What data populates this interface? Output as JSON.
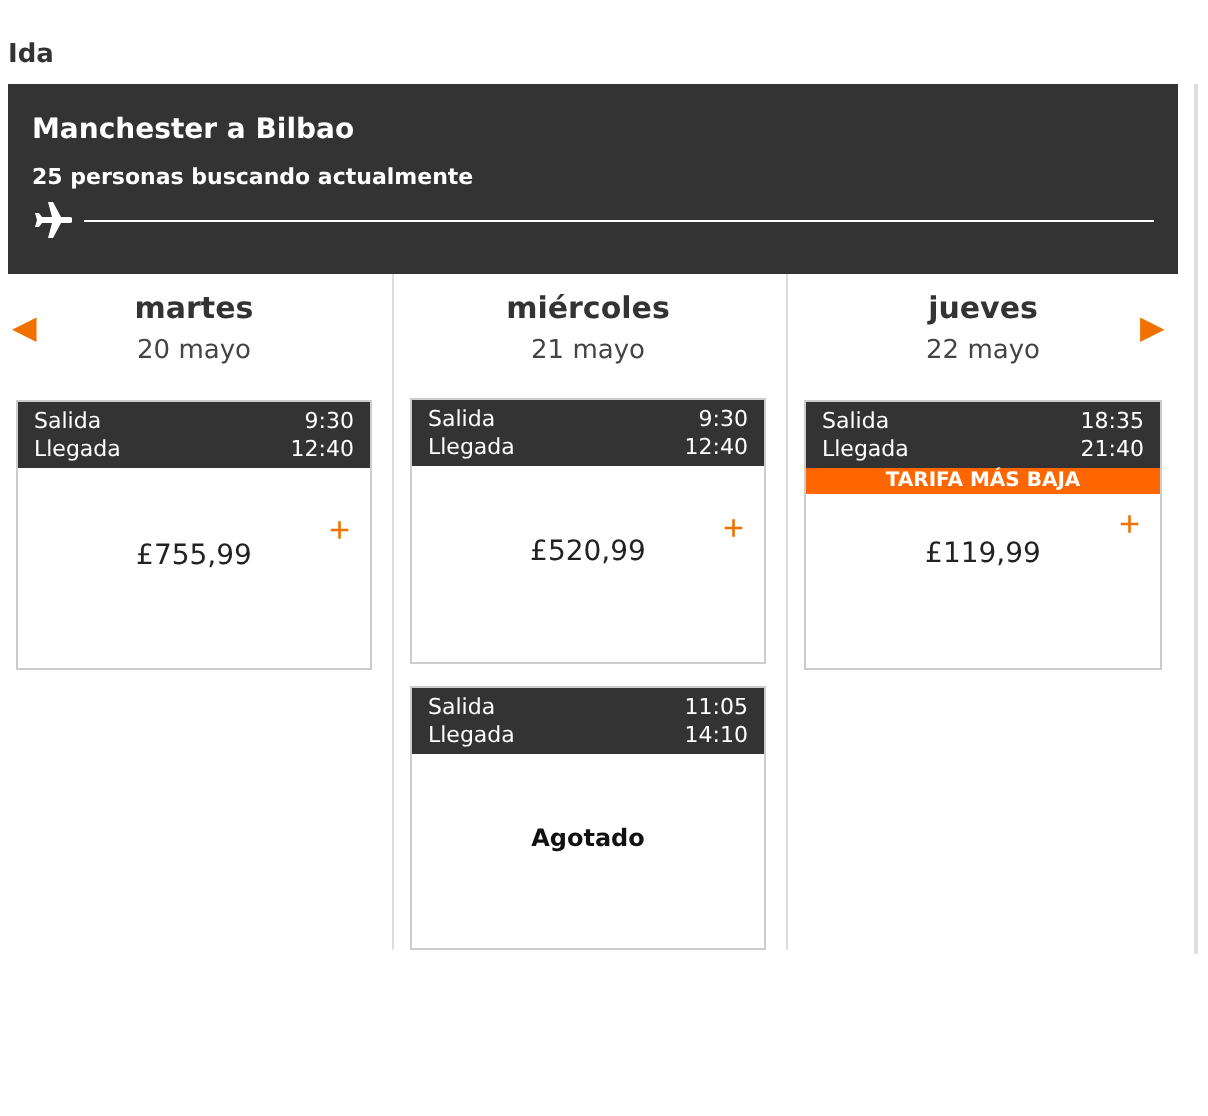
{
  "section_title": "Ida",
  "route": {
    "title": "Manchester a Bilbao",
    "subtitle": "25 personas buscando actualmente"
  },
  "nav": {
    "prev": "◀",
    "next": "▶"
  },
  "days": [
    {
      "weekday": "martes",
      "date": "20 mayo",
      "flights": [
        {
          "kind": "price",
          "departure_label": "Salida",
          "departure": "9:30",
          "arrival_label": "Llegada",
          "arrival": "12:40",
          "price": "£755,99",
          "add": "+"
        }
      ]
    },
    {
      "weekday": "miércoles",
      "date": "21 mayo",
      "flights": [
        {
          "kind": "price",
          "departure_label": "Salida",
          "departure": "9:30",
          "arrival_label": "Llegada",
          "arrival": "12:40",
          "price": "£520,99",
          "add": "+"
        },
        {
          "kind": "sold_out",
          "departure_label": "Salida",
          "departure": "11:05",
          "arrival_label": "Llegada",
          "arrival": "14:10",
          "status": "Agotado"
        }
      ]
    },
    {
      "weekday": "jueves",
      "date": "22 mayo",
      "flights": [
        {
          "kind": "price",
          "departure_label": "Salida",
          "departure": "18:35",
          "arrival_label": "Llegada",
          "arrival": "21:40",
          "badge": "TARIFA MÁS BAJA",
          "price": "£119,99",
          "add": "+"
        }
      ]
    }
  ]
}
